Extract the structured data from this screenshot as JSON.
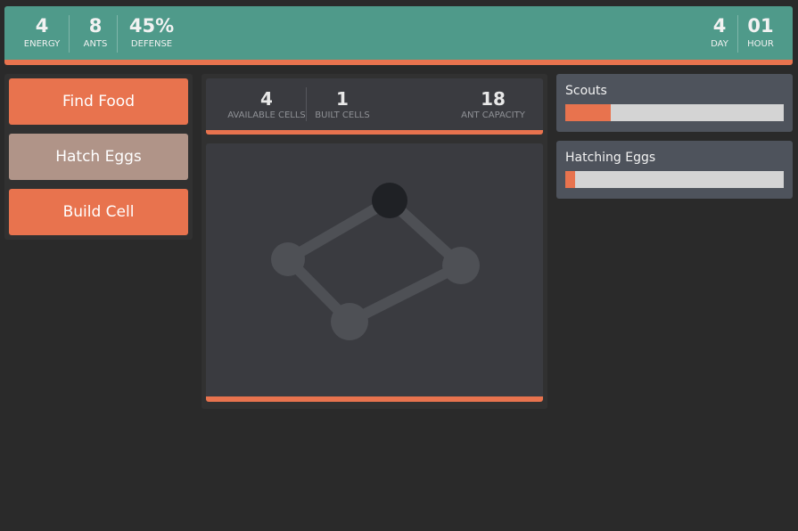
{
  "topbar": {
    "energy": {
      "value": "4",
      "label": "ENERGY"
    },
    "ants": {
      "value": "8",
      "label": "ANTS"
    },
    "defense": {
      "value": "45%",
      "label": "DEFENSE"
    },
    "day": {
      "value": "4",
      "label": "DAY"
    },
    "hour": {
      "value": "01",
      "label": "HOUR"
    }
  },
  "actions": {
    "find_food": "Find Food",
    "hatch_eggs": "Hatch Eggs",
    "build_cell": "Build Cell"
  },
  "cells": {
    "available": {
      "value": "4",
      "label": "AVAILABLE CELLS"
    },
    "built": {
      "value": "1",
      "label": "BUILT CELLS"
    },
    "capacity": {
      "value": "18",
      "label": "ANT CAPACITY"
    }
  },
  "progress": {
    "scouts": {
      "label": "Scouts",
      "fraction": 0.21
    },
    "hatching": {
      "label": "Hatching Eggs",
      "fraction": 0.045
    }
  },
  "colors": {
    "topbar": "#4f9a8a",
    "accent": "#e8734e",
    "disabled_button": "#b09488",
    "panel": "#3a3b40",
    "built_cell": "#1f2125",
    "unbuilt_cell": "#4e5055",
    "track": "#d4d4d4"
  },
  "colony_map": {
    "nodes": [
      {
        "id": "top",
        "built": true
      },
      {
        "id": "left",
        "built": false
      },
      {
        "id": "right",
        "built": false
      },
      {
        "id": "bottom",
        "built": false
      }
    ],
    "edges": [
      [
        "top",
        "left"
      ],
      [
        "top",
        "right"
      ],
      [
        "left",
        "bottom"
      ],
      [
        "bottom",
        "right"
      ]
    ]
  }
}
